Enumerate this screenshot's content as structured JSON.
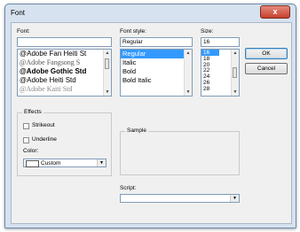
{
  "window": {
    "title": "Font",
    "close_glyph": "x"
  },
  "font": {
    "label": "Font:",
    "value": "",
    "items": [
      "@Adobe Fan Heiti St",
      "@Adobe Fangsong S",
      "@Adobe Gothic Std",
      "@Adobe Heiti Std",
      "@Adobe Kaiti Std"
    ]
  },
  "font_style": {
    "label": "Font style:",
    "value": "Regular",
    "items": [
      "Regular",
      "Italic",
      "Bold",
      "Bold Italic"
    ],
    "selected_index": 0
  },
  "size": {
    "label": "Size:",
    "value": "16",
    "items": [
      "16",
      "18",
      "20",
      "22",
      "24",
      "26",
      "28"
    ],
    "selected_index": 0
  },
  "buttons": {
    "ok": "OK",
    "cancel": "Cancel"
  },
  "effects": {
    "label": "Effects",
    "strikeout": "Strikeout",
    "underline": "Underline",
    "color_label": "Color:",
    "color_value": "Custom",
    "color_swatch": "#ffffff"
  },
  "sample": {
    "label": "Sample"
  },
  "script": {
    "label": "Script:",
    "value": ""
  },
  "colors": {
    "selection": "#3399ff",
    "frame": "#d6e2ef",
    "close": "#c7402c"
  }
}
